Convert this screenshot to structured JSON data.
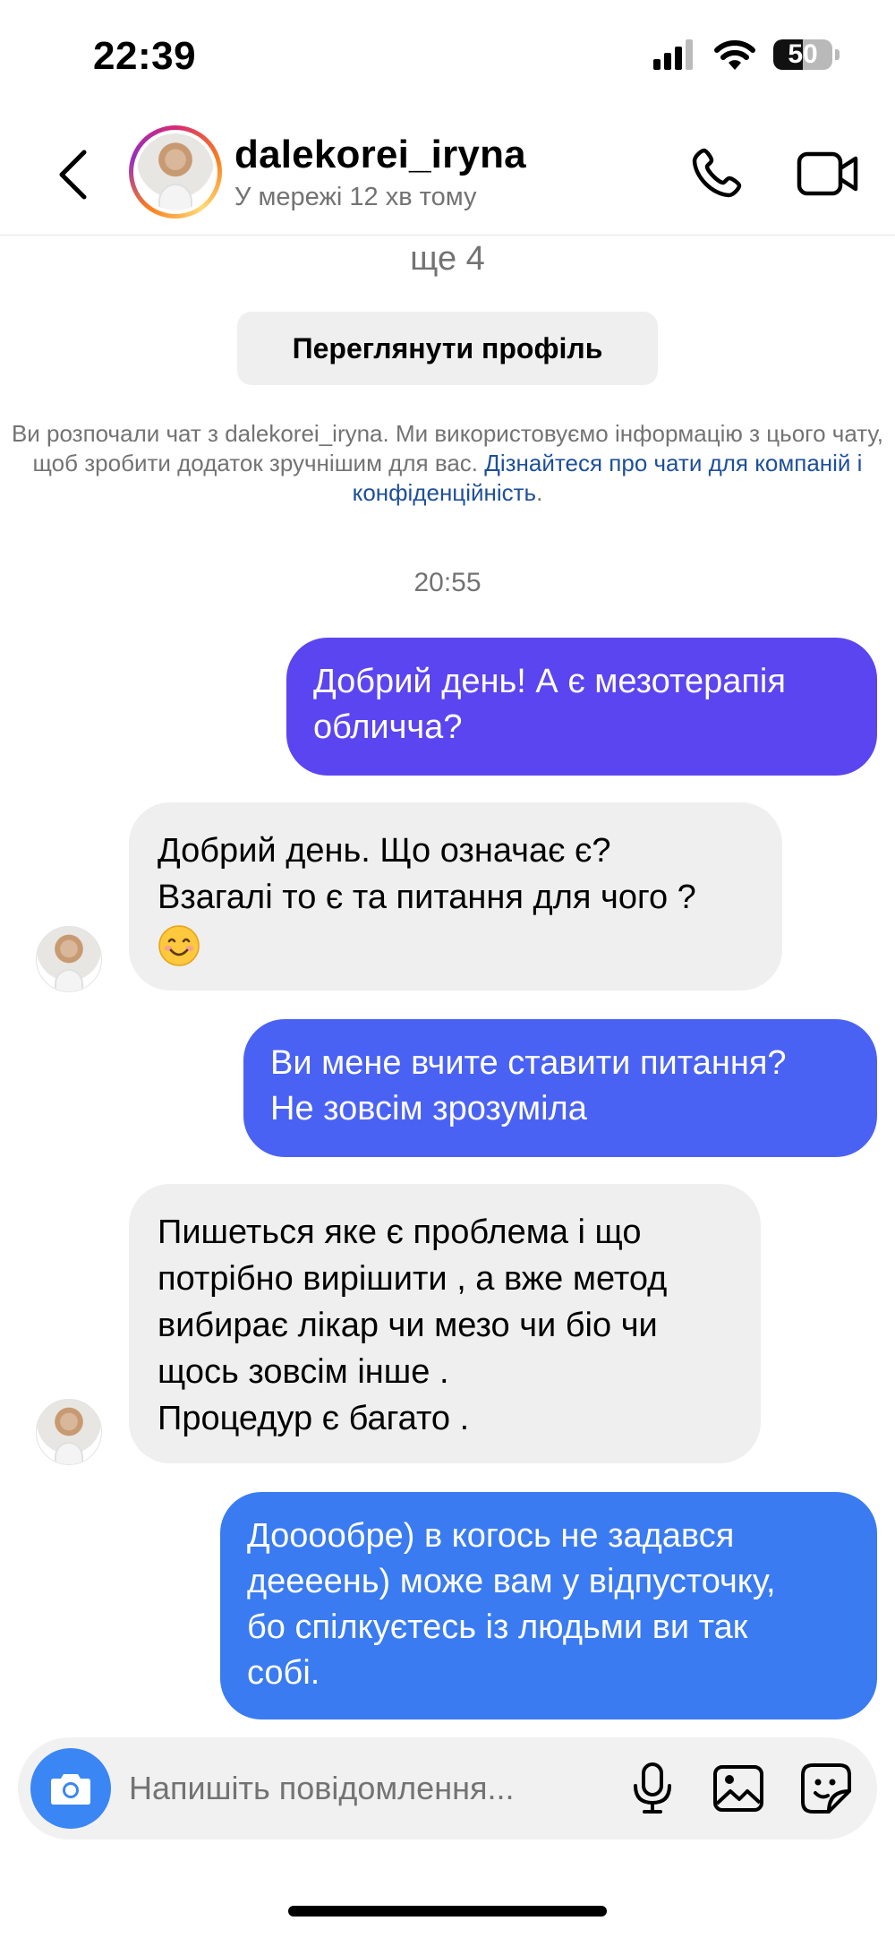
{
  "status_bar": {
    "time": "22:39",
    "battery": "50",
    "battery_level_percent": 50,
    "icons": [
      "signal-icon",
      "wifi-icon",
      "battery-icon"
    ]
  },
  "header": {
    "username": "dalekorei_iryna",
    "status": "У мережі 12 хв тому",
    "icons": [
      "back-icon",
      "phone-icon",
      "video-camera-icon"
    ]
  },
  "info": {
    "more_count": "ще 4",
    "view_profile": "Переглянути профіль",
    "notice_text": "Ви розпочали чат з dalekorei_iryna. Ми використовуємо інформацію з цього чату, щоб зробити додаток зручнішим для вас. ",
    "notice_link": "Дізнайтеся про чати для компаній і конфіденційність",
    "notice_end": "."
  },
  "timestamp": "20:55",
  "messages": [
    {
      "from": "me",
      "lines": [
        "Добрий день! А є мезотерапія",
        "обличча?"
      ]
    },
    {
      "from": "them",
      "lines": [
        "Добрий день. Що означає є?",
        "Взагалі то є та питання для чого ?"
      ],
      "emoji": "smiling-face-emoji"
    },
    {
      "from": "me",
      "lines": [
        "Ви мене вчите ставити питання?",
        "Не зовсім зрозуміла"
      ]
    },
    {
      "from": "them",
      "lines": [
        "Пишеться яке є проблема і що",
        "потрібно вирішити , а вже метод",
        "вибирає лікар чи мезо чи біо чи",
        "щось зовсім інше .",
        "Процедур є багато ."
      ]
    },
    {
      "from": "me",
      "lines": [
        "Дооообре) в когось не задався",
        "деееень) може вам у відпусточку,",
        "бо спілкуєтесь із людьми ви так",
        "собі."
      ]
    }
  ],
  "colors": {
    "bubble_1": "#5b45f0",
    "bubble_3": "#4a62f4",
    "bubble_5": "#3a7bf1",
    "incoming_bubble": "#efefef",
    "camera_button": "#3a86f5"
  },
  "composer": {
    "placeholder": "Напишіть повідомлення...",
    "icons": [
      "camera-icon",
      "microphone-icon",
      "gallery-icon",
      "sticker-icon"
    ]
  }
}
